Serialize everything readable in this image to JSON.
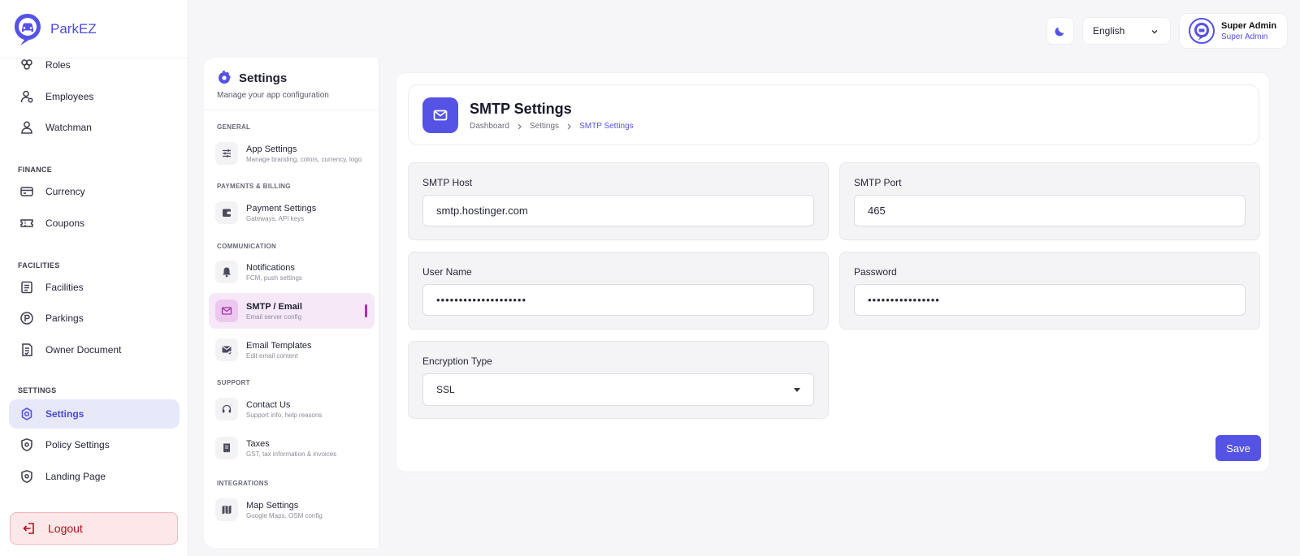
{
  "app": {
    "brand": "ParkEZ"
  },
  "sidebar": {
    "sections": {
      "finance": "FINANCE",
      "facilities": "FACILITIES",
      "settings": "SETTINGS"
    },
    "items": {
      "roles": "Roles",
      "employees": "Employees",
      "watchman": "Watchman",
      "currency": "Currency",
      "coupons": "Coupons",
      "facilities": "Facilities",
      "parkings": "Parkings",
      "owner_document": "Owner Document",
      "settings": "Settings",
      "policy_settings": "Policy Settings",
      "landing_page": "Landing Page"
    },
    "active_item": "settings",
    "logout": "Logout"
  },
  "header": {
    "language": "English",
    "user": {
      "name": "Super Admin",
      "role": "Super Admin"
    }
  },
  "settings_menu": {
    "title": "Settings",
    "subtitle": "Manage your app configuration",
    "groups": {
      "general": "GENERAL",
      "payments": "PAYMENTS & BILLING",
      "communication": "COMMUNICATION",
      "support": "SUPPORT",
      "integrations": "INTEGRATIONS"
    },
    "items": {
      "app_settings": {
        "title": "App Settings",
        "desc": "Manage branding, colors, currency, logo"
      },
      "payment_settings": {
        "title": "Payment Settings",
        "desc": "Gateways, API keys"
      },
      "notifications": {
        "title": "Notifications",
        "desc": "FCM, push settings"
      },
      "smtp_email": {
        "title": "SMTP / Email",
        "desc": "Email server config"
      },
      "email_templates": {
        "title": "Email Templates",
        "desc": "Edit email content"
      },
      "contact_us": {
        "title": "Contact Us",
        "desc": "Support info, help reasons"
      },
      "taxes": {
        "title": "Taxes",
        "desc": "GST, tax information & invoices"
      },
      "map_settings": {
        "title": "Map Settings",
        "desc": "Google Maps, OSM config"
      }
    },
    "active_item": "smtp_email"
  },
  "page": {
    "title": "SMTP Settings",
    "breadcrumb": [
      "Dashboard",
      "Settings",
      "SMTP Settings"
    ]
  },
  "form": {
    "smtp_host": {
      "label": "SMTP Host",
      "value": "smtp.hostinger.com"
    },
    "smtp_port": {
      "label": "SMTP Port",
      "value": "465"
    },
    "user_name": {
      "label": "User Name",
      "value": "••••••••••••••••••••"
    },
    "password": {
      "label": "Password",
      "value": "••••••••••••••••"
    },
    "encryption": {
      "label": "Encryption Type",
      "value": "SSL"
    },
    "save_label": "Save"
  },
  "colors": {
    "accent": "#5552e6",
    "active_sub_item_bg": "#f7e8f8",
    "active_sub_item_accent": "#a631ad",
    "logout_bg": "#fde7e8",
    "logout_text": "#b3121d"
  },
  "icons": {
    "brand": "parkez-logo-icon",
    "theme_toggle": "moon-icon",
    "language_chevron": "chevron-down-icon",
    "page_header": "mail-icon"
  }
}
